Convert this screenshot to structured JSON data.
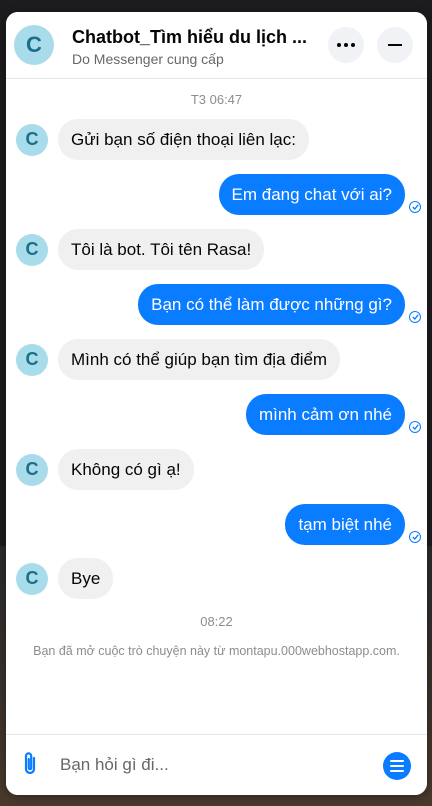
{
  "header": {
    "avatar_letter": "C",
    "title": "Chatbot_Tìm hiểu du lịch ...",
    "subtitle": "Do Messenger cung cấp"
  },
  "messages": [
    {
      "type": "timestamp",
      "text": "T3 06:47"
    },
    {
      "type": "in",
      "text": "Gửi bạn số điện thoại liên lạc:"
    },
    {
      "type": "out",
      "text": "Em đang chat với ai?"
    },
    {
      "type": "in",
      "text": "Tôi là bot. Tôi tên Rasa!"
    },
    {
      "type": "out",
      "text": "Bạn có thể làm được những gì?"
    },
    {
      "type": "in",
      "text": "Mình có thể giúp bạn tìm địa điểm"
    },
    {
      "type": "out",
      "text": "mình cảm ơn nhé"
    },
    {
      "type": "in",
      "text": "Không có gì ạ!"
    },
    {
      "type": "out",
      "text": "tạm biệt nhé"
    },
    {
      "type": "in",
      "text": "Bye"
    },
    {
      "type": "timestamp",
      "text": "08:22"
    }
  ],
  "notice": "Bạn đã mở cuộc trò chuyện này từ montapu.000webhostapp.com.",
  "composer": {
    "placeholder": "Bạn hỏi gì đi..."
  },
  "colors": {
    "accent": "#0a7cff",
    "incoming_bubble": "#f0f0f0",
    "avatar_bg": "#a8dceb"
  }
}
